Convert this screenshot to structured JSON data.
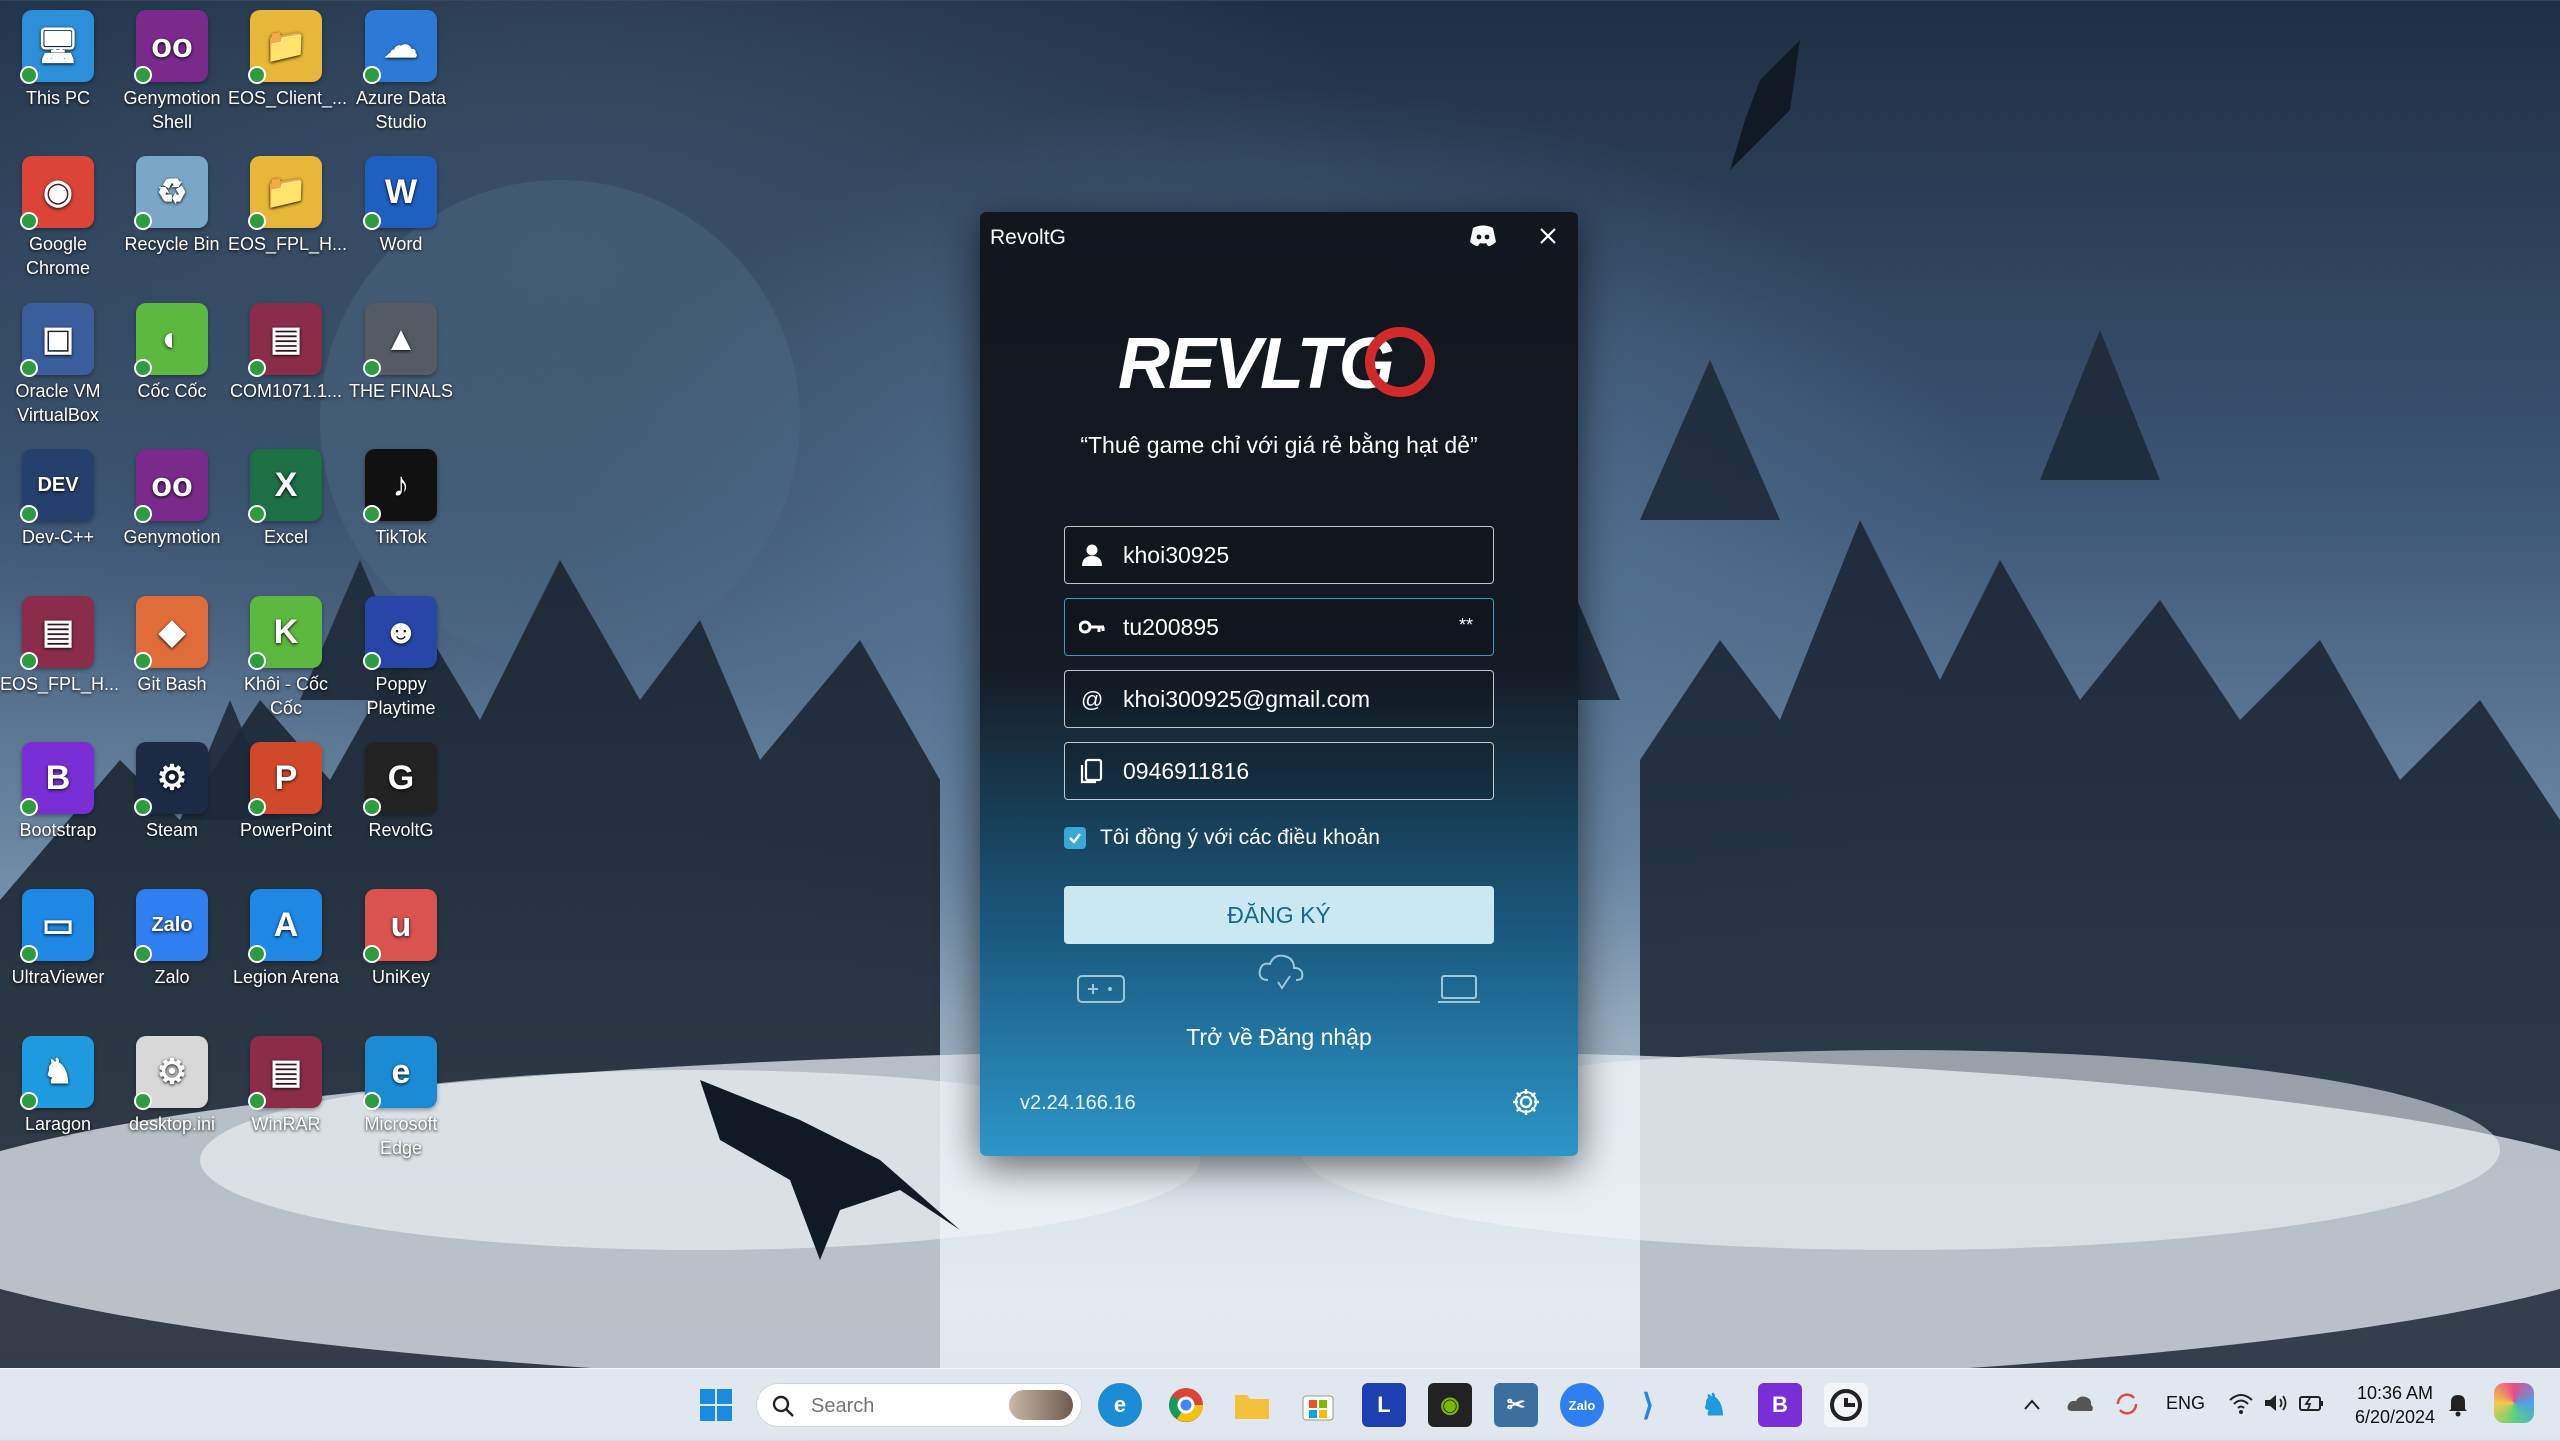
{
  "desktop": {
    "icons": [
      {
        "label": "This PC",
        "color": "#2d8fd8",
        "glyph": "🖥"
      },
      {
        "label": "Genymotion Shell",
        "color": "#7a2a8a",
        "glyph": "oo"
      },
      {
        "label": "EOS_Client_...",
        "color": "#e7b73a",
        "glyph": "📁"
      },
      {
        "label": "Azure Data Studio",
        "color": "#2b7bd6",
        "glyph": "☁"
      },
      {
        "label": "Google Chrome",
        "color": "#db4437",
        "glyph": "◉"
      },
      {
        "label": "Recycle Bin",
        "color": "#7aa7c7",
        "glyph": "♻"
      },
      {
        "label": "EOS_FPL_H...",
        "color": "#e7b73a",
        "glyph": "📁"
      },
      {
        "label": "Word",
        "color": "#1f5fbf",
        "glyph": "W"
      },
      {
        "label": "Oracle VM VirtualBox",
        "color": "#3a5d9c",
        "glyph": "▣"
      },
      {
        "label": "Cốc Cốc",
        "color": "#5db83f",
        "glyph": "◐"
      },
      {
        "label": "COM1071.1...",
        "color": "#8a2c4a",
        "glyph": "▤"
      },
      {
        "label": "THE FINALS",
        "color": "#555b63",
        "glyph": "▲"
      },
      {
        "label": "Dev-C++",
        "color": "#26406e",
        "glyph": "DEV"
      },
      {
        "label": "Genymotion",
        "color": "#7a2a8a",
        "glyph": "oo"
      },
      {
        "label": "Excel",
        "color": "#1d7044",
        "glyph": "X"
      },
      {
        "label": "TikTok",
        "color": "#111111",
        "glyph": "♪"
      },
      {
        "label": "EOS_FPL_H...",
        "color": "#8a2c4a",
        "glyph": "▤"
      },
      {
        "label": "Git Bash",
        "color": "#e06c3a",
        "glyph": "◆"
      },
      {
        "label": "Khôi - Cốc Cốc",
        "color": "#5db83f",
        "glyph": "K"
      },
      {
        "label": "Poppy Playtime",
        "color": "#2746a8",
        "glyph": "☻"
      },
      {
        "label": "Bootstrap",
        "color": "#7a2fd6",
        "glyph": "B"
      },
      {
        "label": "Steam",
        "color": "#1b2a45",
        "glyph": "⚙"
      },
      {
        "label": "PowerPoint",
        "color": "#d0492a",
        "glyph": "P"
      },
      {
        "label": "RevoltG",
        "color": "#222222",
        "glyph": "G"
      },
      {
        "label": "UltraViewer",
        "color": "#1e88e5",
        "glyph": "▭"
      },
      {
        "label": "Zalo",
        "color": "#2f7ff0",
        "glyph": "Zalo"
      },
      {
        "label": "Legion Arena",
        "color": "#1e88e5",
        "glyph": "A"
      },
      {
        "label": "UniKey",
        "color": "#d9534f",
        "glyph": "u"
      },
      {
        "label": "Laragon",
        "color": "#1e9ae0",
        "glyph": "♞"
      },
      {
        "label": "desktop.ini",
        "color": "#d8d8d8",
        "glyph": "⚙"
      },
      {
        "label": "WinRAR",
        "color": "#8a2c4a",
        "glyph": "▤"
      },
      {
        "label": "Microsoft Edge",
        "color": "#1b8bd6",
        "glyph": "e"
      }
    ]
  },
  "dialog": {
    "title": "RevoltG",
    "logo_text": "REVLTG",
    "slogan": "“Thuê game chỉ với giá rẻ bằng hạt dẻ”",
    "username": {
      "value": "khoi30925",
      "icon": "user-icon"
    },
    "password": {
      "value": "tu200895",
      "peek": "**",
      "icon": "key-icon"
    },
    "email": {
      "value": "khoi300925@gmail.com",
      "icon": "at-icon"
    },
    "phone": {
      "value": "0946911816",
      "icon": "phone-icon"
    },
    "terms_label": "Tôi đồng ý với các điều khoản",
    "terms_checked": true,
    "register_label": "ĐĂNG KÝ",
    "back_to_login": "Trở về Đăng nhập",
    "version": "v2.24.166.16",
    "accent": "#37a8d8"
  },
  "taskbar": {
    "search_placeholder": "Search",
    "apps": [
      "windows-start",
      "search",
      "edge",
      "chrome",
      "file-explorer",
      "microsoft-store",
      "l-app",
      "nvidia",
      "snipping-tool",
      "zalo",
      "vscode",
      "laragon",
      "bootstrap",
      "revoltg"
    ],
    "tray_lang": "ENG",
    "time": "10:36 AM",
    "date": "6/20/2024"
  }
}
